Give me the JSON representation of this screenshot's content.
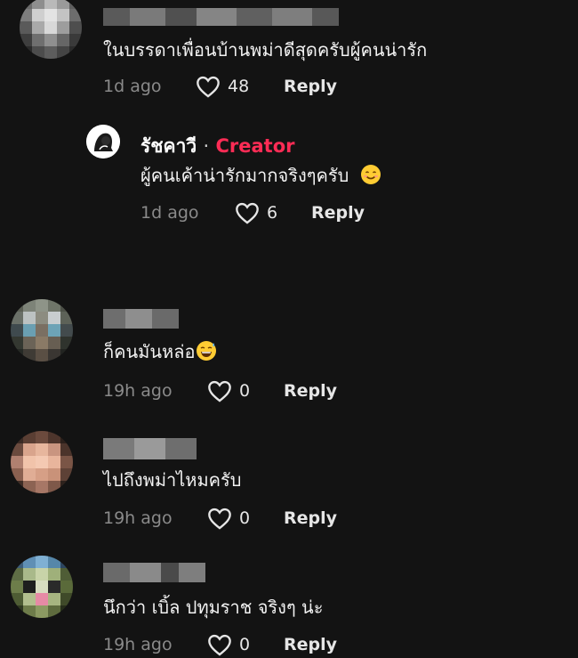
{
  "comments": [
    {
      "text": "ในบรรดาเพื่อนบ้านพม่าดีสุดครับผู้คนน่ารัก",
      "time": "1d ago",
      "likes": "48",
      "reply_label": "Reply"
    },
    {
      "author": "รัชคาวี",
      "separator": "·",
      "badge": "Creator",
      "text": "ผู้คนเค้าน่ารักมากจริงๆครับ",
      "time": "1d ago",
      "likes": "6",
      "reply_label": "Reply"
    },
    {
      "text": "ก็คนมันหล่อ",
      "time": "19h ago",
      "likes": "0",
      "reply_label": "Reply"
    },
    {
      "text": "ไปถึงพม่าไหมครับ",
      "time": "19h ago",
      "likes": "0",
      "reply_label": "Reply"
    },
    {
      "text": "นึกว่า เบิ้ล ปทุมราช จริงๆ น่ะ",
      "time": "19h ago",
      "likes": "0",
      "reply_label": "Reply"
    }
  ],
  "icons": {
    "like": "heart-outline-icon",
    "smile_emoji": "smiling-face-emoji",
    "sweat_emoji": "grinning-sweat-emoji"
  },
  "colors": {
    "background": "#131313",
    "creator_badge": "#fe2c55",
    "meta_text": "#8a8a8a"
  }
}
